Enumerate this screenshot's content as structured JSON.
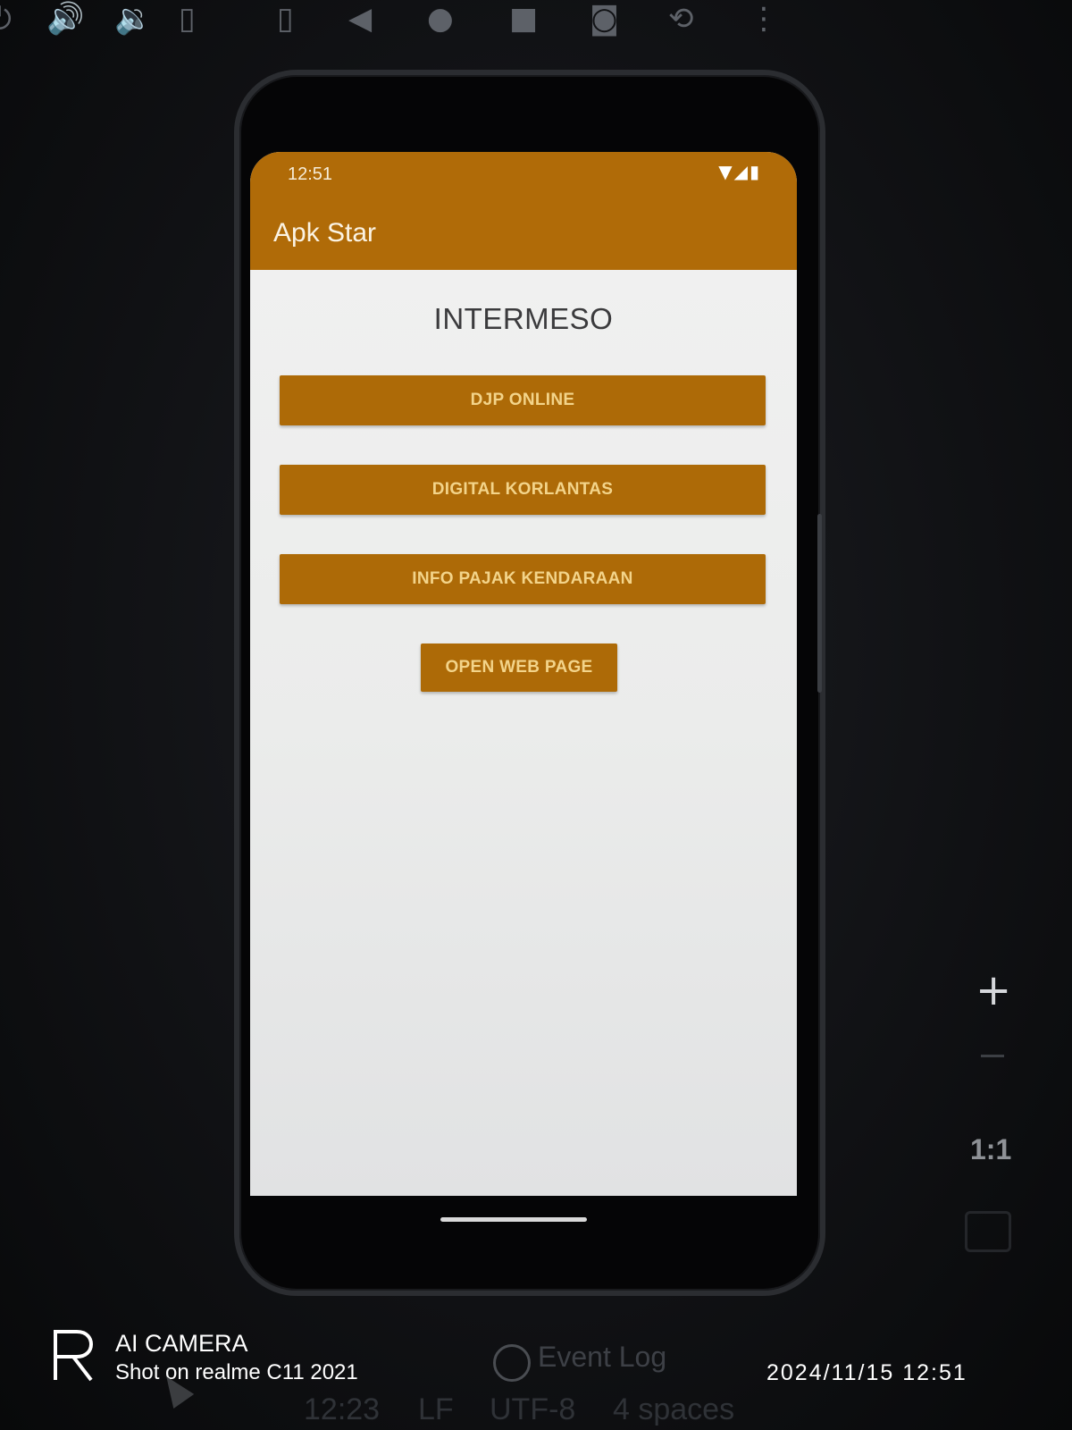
{
  "emulator": {
    "toolbar": [
      {
        "icon": "power-icon",
        "glyph": "⏻"
      },
      {
        "icon": "volume-up-icon",
        "glyph": "🔊"
      },
      {
        "icon": "volume-down-icon",
        "glyph": "🔉"
      },
      {
        "icon": "rotate-left-icon",
        "glyph": "▯"
      },
      {
        "icon": "rotate-right-icon",
        "glyph": "▯"
      },
      {
        "icon": "back-icon",
        "glyph": "◀"
      },
      {
        "icon": "home-icon",
        "glyph": "●"
      },
      {
        "icon": "overview-icon",
        "glyph": "■"
      },
      {
        "icon": "camera-icon",
        "glyph": "◙"
      },
      {
        "icon": "snapshot-icon",
        "glyph": "⟲"
      },
      {
        "icon": "more-icon",
        "glyph": "⋮"
      }
    ],
    "side_controls": {
      "zoom_in": "+",
      "ratio": "1:1"
    }
  },
  "status_bar": {
    "time": "12:51",
    "icons": [
      "wifi-icon",
      "signal-icon",
      "battery-icon"
    ],
    "icons_glyph": "▼◢▮"
  },
  "app": {
    "title": "Apk Star",
    "accent_color": "#b06b08",
    "heading": "INTERMESO",
    "buttons": [
      {
        "label": "DJP ONLINE"
      },
      {
        "label": "DIGITAL KORLANTAS"
      },
      {
        "label": "INFO PAJAK KENDARAAN"
      },
      {
        "label": "OPEN WEB PAGE"
      }
    ]
  },
  "ide_status": {
    "event_log": "Event Log",
    "time": "12:23",
    "line_ending": "LF",
    "encoding": "UTF-8",
    "indent": "4 spaces"
  },
  "watermark": {
    "title": "AI CAMERA",
    "subtitle": "Shot on realme C11 2021",
    "datetime": "2024/11/15  12:51"
  }
}
